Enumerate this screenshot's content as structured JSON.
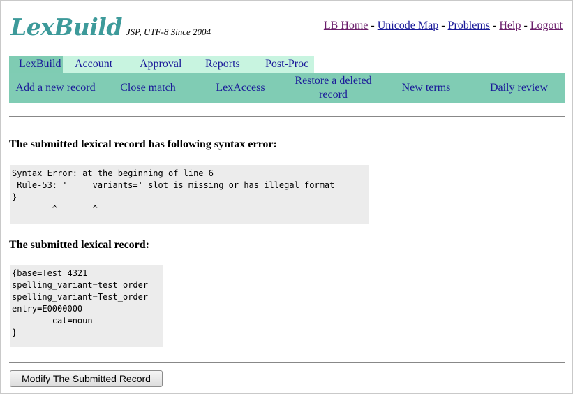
{
  "logo": {
    "title": "LexBuild",
    "subtitle": "JSP, UTF-8 Since 2004"
  },
  "toplinks": {
    "home": "LB Home",
    "unicode": "Unicode Map",
    "problems": "Problems",
    "help": "Help",
    "logout": "Logout",
    "separator": " - "
  },
  "tabs": [
    "LexBuild",
    "Account",
    "Approval",
    "Reports",
    "Post-Proc"
  ],
  "subnav": [
    "Add a new record",
    "Close match",
    "LexAccess",
    "Restore a deleted record",
    "New terms",
    "Daily review"
  ],
  "error_heading": "The submitted lexical record has following syntax error:",
  "error_text": "Syntax Error: at the beginning of line 6\n Rule-53: '     variants=' slot is missing or has illegal format\n}\n        ^       ^",
  "record_heading": "The submitted lexical record:",
  "record_text": "{base=Test 4321\nspelling_variant=test order\nspelling_variant=Test_order\nentry=E0000000\n        cat=noun\n}",
  "button_label": "Modify The Submitted Record",
  "colors": {
    "logo": "#3d9a9a",
    "tab_bg": "#c8f4e0",
    "tab_active": "#7fccb3",
    "subnav_bg": "#80ccb4",
    "code_bg": "#ececec",
    "link": "#1a1a99",
    "visited": "#6b1f6b"
  }
}
